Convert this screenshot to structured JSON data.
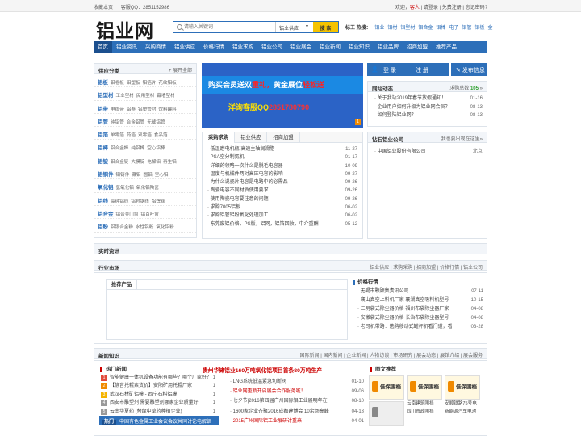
{
  "topbar": {
    "bookmark": "收藏本页",
    "service_qq": "客服QQ：2851152986",
    "welcome": "欢迎，",
    "guest": "客人",
    "login_link": "请登录",
    "register_link": "免费注册",
    "forgot": "忘记密码?",
    "sep": "|"
  },
  "logo": "铝业网",
  "search": {
    "placeholder": "请输入关键词",
    "category": "铝业供应",
    "button": "搜 索"
  },
  "hot_search": {
    "label": "标王 热搜：",
    "items": [
      "铝业",
      "铝材",
      "铝型材",
      "铝合金",
      "铝棒",
      "电子",
      "铝管",
      "铝板",
      "金"
    ]
  },
  "nav": [
    "首页",
    "铝业资讯",
    "采购商情",
    "铝业供应",
    "价格行情",
    "铝业求购",
    "铝业公司",
    "铝业展会",
    "铝业新闻",
    "铝业知识",
    "铝业品牌",
    "招商加盟",
    "推荐产品"
  ],
  "categories": {
    "title": "供应分类",
    "expand": "展开全部",
    "rows": [
      {
        "name": "铝板",
        "items": [
          "铝卷板",
          "铝塑板",
          "铝箔片",
          "花纹铝板"
        ]
      },
      {
        "name": "铝型材",
        "items": [
          "工业型材",
          "民用型材",
          "幕墙型材"
        ]
      },
      {
        "name": "铝带",
        "items": [
          "电缆带",
          "铝卷",
          "铝塑管材",
          "饮料罐料"
        ]
      },
      {
        "name": "铝管",
        "items": [
          "纯铝管",
          "合金铝管",
          "无缝铝管"
        ]
      },
      {
        "name": "铝箔",
        "items": [
          "单零箔",
          "药箔",
          "双零箔",
          "食品箔"
        ]
      },
      {
        "name": "铝棒",
        "items": [
          "铝合金棒",
          "纯铝棒",
          "空心铝棒"
        ]
      },
      {
        "name": "铝锭",
        "items": [
          "铝合金锭",
          "大模锭",
          "电解铝",
          "再生铝"
        ]
      },
      {
        "name": "铝铜件",
        "items": [
          "铝铸件",
          "藏铝",
          "圆铝",
          "空心铝"
        ]
      },
      {
        "name": "氧化铝",
        "items": [
          "氢氧化铝",
          "氧化铝陶瓷"
        ]
      },
      {
        "name": "铝线",
        "items": [
          "高纯铝线",
          "铝包钢线",
          "铝焊丝"
        ]
      },
      {
        "name": "铝合金",
        "items": [
          "铝合金门窗",
          "铝百叶窗"
        ]
      },
      {
        "name": "铝粉",
        "items": [
          "铝银合金粉",
          "水性铝粉",
          "氧化铝粉"
        ]
      }
    ]
  },
  "banner": {
    "line1_a": "购买会员送双",
    "line1_b": "重礼，",
    "line1_c": "黄金展位",
    "line1_d": "轻松送",
    "line2_a": "洋询客服QQ",
    "line2_b": "2851780790",
    "page": "1"
  },
  "tabs": {
    "items": [
      "采购求购",
      "铝业供应",
      "招商加盟"
    ],
    "news": [
      {
        "t": "· 低温磨电机瓶 高速主轴润滑脂",
        "d": "11-27"
      },
      {
        "t": "· PSA空分制氮机",
        "d": "01-17"
      },
      {
        "t": "· 详细的领略一次什么是脱毛电容器",
        "d": "10-09"
      },
      {
        "t": "· 温度与机械件两对高压电容的影响",
        "d": "09-27"
      },
      {
        "t": "· 为什么说瓷片电容是电路中的必需品",
        "d": "09-26"
      },
      {
        "t": "· 陶瓷电容不同材质使用要求",
        "d": "09-26"
      },
      {
        "t": "· 使用陶瓷电容要注意的问题",
        "d": "09-26"
      },
      {
        "t": "· 求购7005铝板",
        "d": "06-02"
      },
      {
        "t": "· 求购铝管铝粉氧化处理加工",
        "d": "06-02"
      },
      {
        "t": "· 东莞废铝价格，PS版，铝网，铝箔回收，中介重酬",
        "d": "05-12"
      }
    ]
  },
  "right_top": {
    "login": "登 录",
    "register": "注 册",
    "publish": "发布信息"
  },
  "dynamics": {
    "title": "网站动态",
    "count_label": "求购总数 ",
    "count": "105",
    "items": [
      {
        "t": "· 关于我站2019年春节放假通知！",
        "d": "01-16"
      },
      {
        "t": "· 企业用户如何升级为铝业网会员？",
        "d": "08-13"
      },
      {
        "t": "· 如何登陆铝业网？",
        "d": "08-13"
      }
    ]
  },
  "gold_vendors": {
    "title": "钻石铝业公司",
    "more": "我也要出现在这里»",
    "items": [
      {
        "t": "· 中国铝业股份有限公司",
        "loc": "北京"
      }
    ]
  },
  "real_news": {
    "title": "实时资讯"
  },
  "market": {
    "title": "行业市场",
    "links": [
      "铝业供应",
      "求购采购",
      "招商加盟",
      "价格行情",
      "铝业公司"
    ],
    "tab": "推荐产品",
    "price_title": "价格行情",
    "price_items": [
      {
        "t": "· 无锡市颗顾集贵讯公司",
        "d": "07-11"
      },
      {
        "t": "· 襄山真空上料机厂家 襄湖真空吸料机型号",
        "d": "10-15"
      },
      {
        "t": "· 三明袋式除尘器价格 福州布袋除尘器厂家",
        "d": "04-08"
      },
      {
        "t": "· 安徽袋式除尘器价格 长治布袋除尘器型号",
        "d": "04-08"
      },
      {
        "t": "· 老司机带路：选购移动式罐杯机看门道，看",
        "d": "03-28"
      }
    ]
  },
  "knowledge": {
    "title": "新闻知识",
    "links": [
      "国际新闻",
      "国内新闻",
      "企业新闻",
      "人物访谈",
      "市场研究",
      "展会动态",
      "展馆介绍",
      "展会服务"
    ],
    "hot_title": "热门新闻",
    "hot": [
      {
        "n": "1",
        "t": "智能健康一体机设备功能有哪些？哪个厂家好？",
        "d": "1",
        "c": "#e24a3b"
      },
      {
        "n": "2",
        "t": "【静音托辊索货价】安阳矿用托辊厂家",
        "d": "1",
        "c": "#f08a00"
      },
      {
        "n": "3",
        "t": "武汉石材矿铝模 - 西宁石料铝膜",
        "d": "1",
        "c": "#f5b400"
      },
      {
        "n": "4",
        "t": "西安市雕塑剂 需要雕塑剂哪家企业质量好",
        "d": "1",
        "c": "#999"
      },
      {
        "n": "5",
        "t": "云南华夏药 (替缘中草药种植企业)",
        "d": "1",
        "c": "#999"
      }
    ],
    "hot_bar_label": "热门",
    "hot_bar_text": "中国有色金属工业会议会议共同讨论电解铝",
    "headline": "贵州华锋铝业160万吨氧化铝项目首条80万吨生产",
    "mid": [
      {
        "t": "· LNG系统低温紧急切断阀",
        "d": "01-10",
        "red": false
      },
      {
        "t": "· 铝业网重新开启展会合作服务啦！",
        "d": "09-06",
        "red": true
      },
      {
        "t": "· 七夕节|2016第四届广州国际铝工业展明年在",
        "d": "08-10",
        "red": false
      },
      {
        "t": "· 1600家企业齐聚2016成都建博会 10余场高峰",
        "d": "04-13",
        "red": false
      },
      {
        "t": "· 2015广州国际铝工业展研讨重来",
        "d": "04-01",
        "red": true
      }
    ],
    "pic_title": "图文推荐",
    "pic_brand": "佳保围档",
    "pics": [
      "云南建筑围挡",
      "安顺铁路75号电",
      "四川市政围挡",
      "新能源汽车电池"
    ]
  }
}
